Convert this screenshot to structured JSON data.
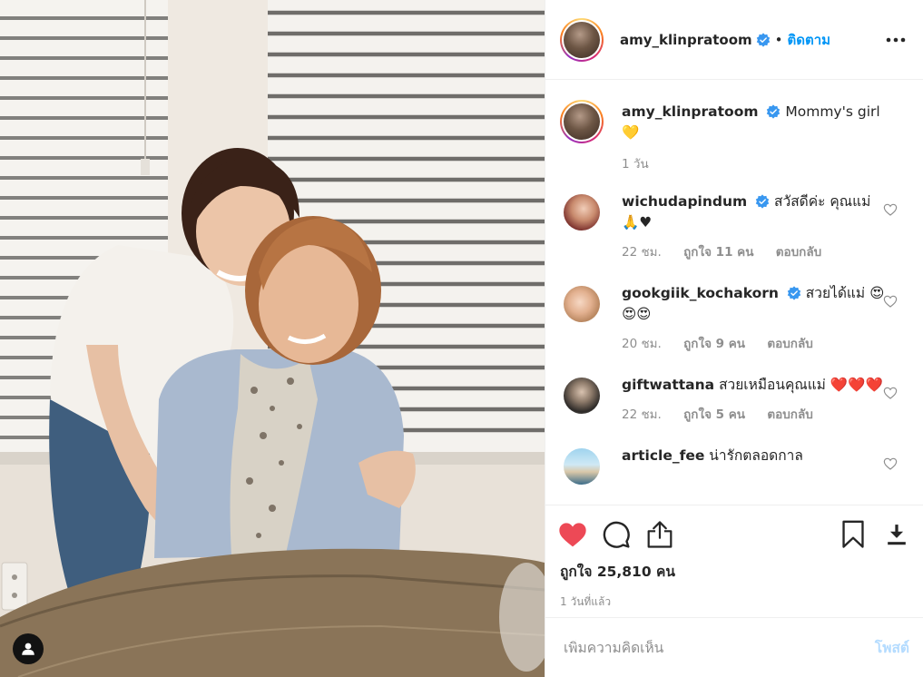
{
  "photo": {
    "alt_description_icon": "user-tag-icon"
  },
  "header": {
    "username": "amy_klinpratoom",
    "separator": "•",
    "follow_label": "ติดตาม",
    "more_icon": "ellipsis-icon"
  },
  "caption": {
    "username": "amy_klinpratoom",
    "text": "Mommy's girl",
    "emoji": "💛",
    "time": "1 วัน"
  },
  "comments": [
    {
      "username": "wichudapindum",
      "verified": true,
      "text": "สวัสดีค่ะ คุณแม่",
      "emoji": "🙏♥",
      "time": "22 ชม.",
      "likes": "ถูกใจ 11 คน",
      "reply": "ตอบกลับ"
    },
    {
      "username": "gookgiik_kochakorn",
      "verified": true,
      "text": "สวยได้แม่",
      "emoji": "😍😍😍",
      "time": "20 ชม.",
      "likes": "ถูกใจ 9 คน",
      "reply": "ตอบกลับ"
    },
    {
      "username": "giftwattana",
      "verified": false,
      "text": "สวยเหมือนคุณแม่",
      "emoji": "❤️❤️❤️",
      "time": "22 ชม.",
      "likes": "ถูกใจ 5 คน",
      "reply": "ตอบกลับ"
    },
    {
      "username": "article_fee",
      "verified": false,
      "text": "น่ารักตลอดกาล",
      "emoji": "",
      "time": "",
      "likes": "",
      "reply": ""
    }
  ],
  "actions": {
    "likes_text": "ถูกใจ 25,810 คน",
    "posted_ago": "1 วันที่แล้ว"
  },
  "composer": {
    "placeholder": "เพิ่มความคิดเห็น",
    "post_label": "โพสต์"
  },
  "colors": {
    "link_blue": "#0095f6",
    "like_red": "#ed4956",
    "post_disabled": "#b3dbff",
    "muted": "#8e8e8e"
  }
}
